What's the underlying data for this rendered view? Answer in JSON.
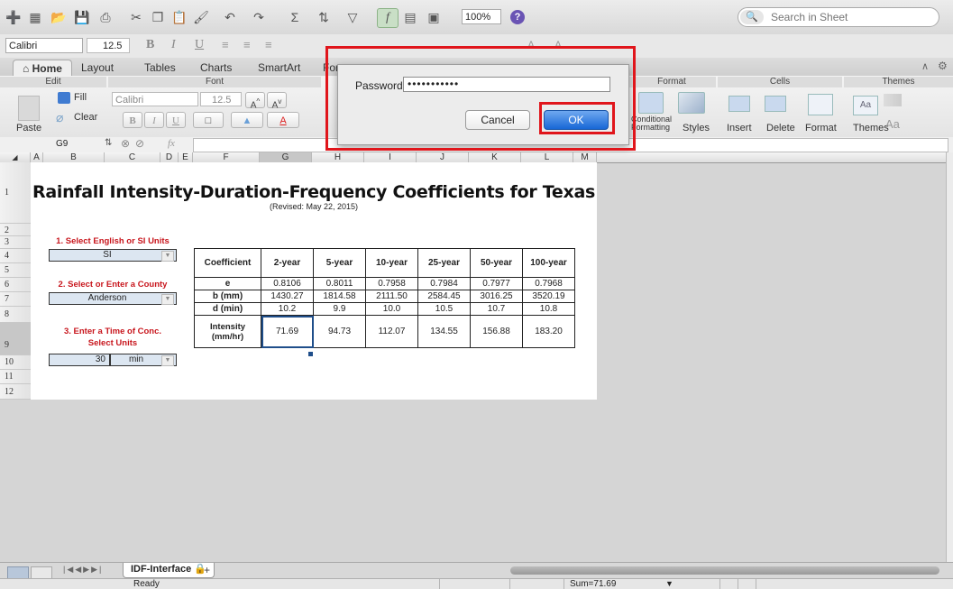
{
  "toolbar": {
    "zoom": "100%",
    "search_placeholder": "Search in Sheet"
  },
  "formatbar": {
    "font_name": "Calibri",
    "font_size": "12.5"
  },
  "ribbon": {
    "tabs": [
      "Home",
      "Layout",
      "Tables",
      "Charts",
      "SmartArt",
      "For"
    ],
    "groups": {
      "edit": "Edit",
      "font": "Font",
      "format": "Format",
      "cells": "Cells",
      "themes": "Themes"
    },
    "fill_label": "Fill",
    "clear_label": "Clear",
    "paste_label": "Paste",
    "font_name": "Calibri",
    "font_size": "12.5",
    "conditional_formatting": "Conditional Formatting",
    "styles": "Styles",
    "insert": "Insert",
    "delete": "Delete",
    "format_btn": "Format",
    "themes_btn": "Themes"
  },
  "formula": {
    "cell_ref": "G9",
    "fx": "fx"
  },
  "columns": [
    "A",
    "B",
    "C",
    "D",
    "E",
    "F",
    "G",
    "H",
    "I",
    "J",
    "K",
    "L",
    "M"
  ],
  "rows": [
    "1",
    "2",
    "3",
    "4",
    "5",
    "6",
    "7",
    "8",
    "9",
    "10",
    "11",
    "12"
  ],
  "sheet": {
    "title": "Rainfall Intensity-Duration-Frequency Coefficients for Texas",
    "subtitle": "(Revised: May 22, 2015)",
    "step1": "1. Select English or SI Units",
    "units_value": "SI",
    "step2": "2. Select or Enter a County",
    "county_value": "Anderson",
    "step3_line1": "3. Enter a Time of Conc.",
    "step3_line2": "Select Units",
    "time_value": "30",
    "time_unit": "min"
  },
  "table": {
    "headers": [
      "Coefficient",
      "2-year",
      "5-year",
      "10-year",
      "25-year",
      "50-year",
      "100-year"
    ],
    "rows": [
      {
        "label": "e",
        "values": [
          "0.8106",
          "0.8011",
          "0.7958",
          "0.7984",
          "0.7977",
          "0.7968"
        ]
      },
      {
        "label": "b (mm)",
        "values": [
          "1430.27",
          "1814.58",
          "2111.50",
          "2584.45",
          "3016.25",
          "3520.19"
        ]
      },
      {
        "label": "d (min)",
        "values": [
          "10.2",
          "9.9",
          "10.0",
          "10.5",
          "10.7",
          "10.8"
        ]
      }
    ],
    "intensity_label": "Intensity (mm/hr)",
    "intensity_values": [
      "71.69",
      "94.73",
      "112.07",
      "134.55",
      "156.88",
      "183.20"
    ]
  },
  "dialog": {
    "password_label": "Password:",
    "password_value": "•••••••••••",
    "cancel_label": "Cancel",
    "ok_label": "OK"
  },
  "sheet_tab": "IDF-Interface",
  "status": {
    "ready": "Ready",
    "sum": "Sum=71.69"
  },
  "colors": {
    "accent_red": "#e0151b",
    "ok_blue": "#1767d6",
    "label_red": "#c8161d",
    "input_blue": "#dce6f1"
  }
}
